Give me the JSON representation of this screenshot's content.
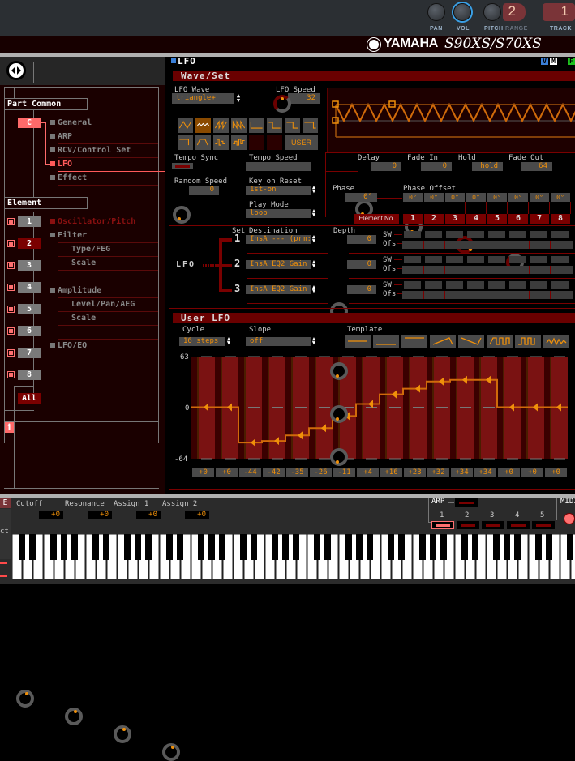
{
  "topbar": {
    "knobs": [
      {
        "label": "PAN",
        "icon": "pan-knob"
      },
      {
        "label": "VOL",
        "icon": "volume-knob"
      },
      {
        "label": "PITCH",
        "icon": "pitch-knob"
      }
    ],
    "range_label": "RANGE",
    "range_value": "2",
    "track_label": "TRACK",
    "track_value": "1",
    "brand": "YAMAHA",
    "model": "S90XS/S70XS"
  },
  "sidebar": {
    "part_common_title": "Part Common",
    "common_button": "C",
    "common_items": [
      {
        "label": "General",
        "active": false
      },
      {
        "label": "ARP",
        "active": false
      },
      {
        "label": "RCV/Control Set",
        "active": false
      },
      {
        "label": "LFO",
        "active": true
      },
      {
        "label": "Effect",
        "active": false
      }
    ],
    "element_title": "Element",
    "element_buttons": [
      "1",
      "2",
      "3",
      "4",
      "5",
      "6",
      "7",
      "8"
    ],
    "selected_element": "2",
    "all_button": "All",
    "element_items": [
      {
        "label": "Oscillator/Pitch",
        "indent": false,
        "bullet": true
      },
      {
        "label": "Filter",
        "indent": false,
        "bullet": true
      },
      {
        "label": "Type/FEG",
        "indent": true,
        "bullet": false
      },
      {
        "label": "Scale",
        "indent": true,
        "bullet": false
      },
      {
        "label": "",
        "indent": false,
        "bullet": false
      },
      {
        "label": "Amplitude",
        "indent": false,
        "bullet": true
      },
      {
        "label": "Level/Pan/AEG",
        "indent": true,
        "bullet": false
      },
      {
        "label": "Scale",
        "indent": true,
        "bullet": false
      },
      {
        "label": "",
        "indent": false,
        "bullet": false
      },
      {
        "label": "LFO/EQ",
        "indent": false,
        "bullet": true
      }
    ],
    "info_icon": "i"
  },
  "main": {
    "title": "LFO",
    "badges": [
      "V",
      "M",
      "F"
    ],
    "wave_set": {
      "header": "Wave/Set",
      "lfo_wave_label": "LFO Wave",
      "lfo_wave_value": "triangle+",
      "lfo_speed_label": "LFO Speed",
      "lfo_speed_value": "32",
      "wave_buttons": [
        "tri",
        "tri+",
        "saw-up",
        "saw-down",
        "squ1/4",
        "squ1/3",
        "squ",
        "squ2/3",
        "squ3/4",
        "trapezoid",
        "S/H1",
        "S/H2",
        "",
        "",
        "USER"
      ],
      "selected_wave": 1,
      "user_label": "USER",
      "tempo_sync_label": "Tempo Sync",
      "tempo_speed_label": "Tempo Speed",
      "tempo_speed_value": "",
      "random_speed_label": "Random Speed",
      "random_speed_value": "0",
      "key_on_reset_label": "Key on Reset",
      "key_on_reset_value": "1st-on",
      "play_mode_label": "Play Mode",
      "play_mode_value": "loop",
      "delay_label": "Delay",
      "delay_value": "0",
      "fade_in_label": "Fade In",
      "fade_in_value": "0",
      "hold_label": "Hold",
      "hold_value": "hold",
      "fade_out_label": "Fade Out",
      "fade_out_value": "64",
      "phase_label": "Phase",
      "phase_value": "0°",
      "phase_offset_label": "Phase Offset",
      "phase_offsets": [
        "0°",
        "0°",
        "0°",
        "0°",
        "0°",
        "0°",
        "0°",
        "0°"
      ],
      "element_no_label": "Element No.",
      "element_numbers": [
        "1",
        "2",
        "3",
        "4",
        "5",
        "6",
        "7",
        "8"
      ]
    },
    "destinations": {
      "lfo_label": "LFO",
      "set_label": "Set",
      "destination_label": "Destination",
      "depth_label": "Depth",
      "sw_label": "SW",
      "ofs_label": "Ofs",
      "rows": [
        {
          "num": "1",
          "destination": "InsA --- (prm:",
          "depth": "0"
        },
        {
          "num": "2",
          "destination": "InsA EQ2 Gain",
          "depth": "0"
        },
        {
          "num": "3",
          "destination": "InsA EQ2 Gain",
          "depth": "0"
        }
      ]
    },
    "user_lfo": {
      "header": "User LFO",
      "cycle_label": "Cycle",
      "cycle_value": "16 steps",
      "slope_label": "Slope",
      "slope_value": "off",
      "template_label": "Template",
      "templates": [
        "all-center",
        "all-min",
        "all-max",
        "saw-up",
        "saw-down",
        "square-wide",
        "square-narrow",
        "random"
      ],
      "y_max_label": "63",
      "y_zero_label": "0",
      "y_min_label": "-64",
      "steps": [
        0,
        0,
        -44,
        -42,
        -35,
        -26,
        -11,
        4,
        16,
        23,
        32,
        34,
        34,
        0,
        0,
        0
      ],
      "step_labels": [
        "+0",
        "+0",
        "-44",
        "-42",
        "-35",
        "-26",
        "-11",
        "+4",
        "+16",
        "+23",
        "+32",
        "+34",
        "+34",
        "+0",
        "+0",
        "+0"
      ]
    }
  },
  "bottom": {
    "knobs": [
      {
        "label": "Cutoff",
        "value": "+0"
      },
      {
        "label": "Resonance",
        "value": "+0"
      },
      {
        "label": "Assign 1",
        "value": "+0"
      },
      {
        "label": "Assign 2",
        "value": "+0"
      }
    ],
    "arp_label": "ARP",
    "arp_buttons": [
      "1",
      "2",
      "3",
      "4",
      "5"
    ],
    "arp_selected": "1",
    "midi_label": "MIDI",
    "left_stub_top": "E",
    "left_stub_mid": "ct"
  },
  "colors": {
    "accent_orange": "#f0900a",
    "header_red": "#6a0000",
    "active_red": "#ff5a5a",
    "panel_bg": "#1a0000"
  }
}
